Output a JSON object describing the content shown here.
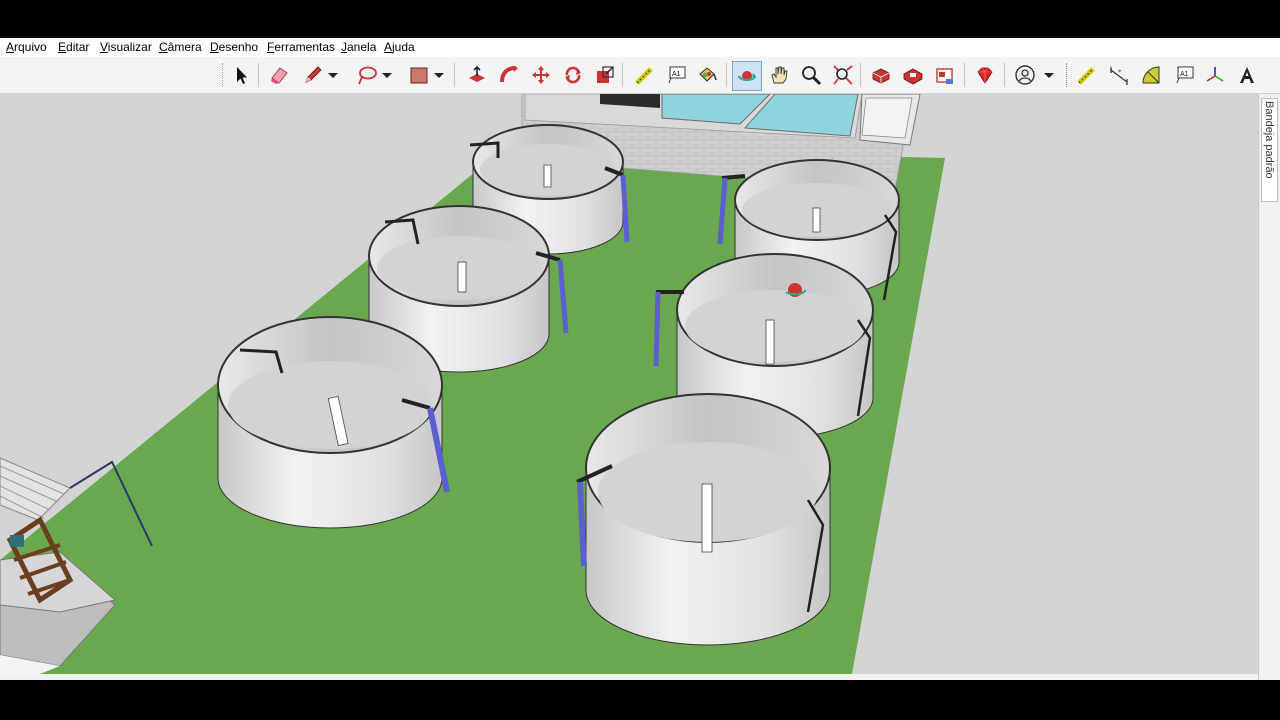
{
  "menu": {
    "items": [
      "Arquivo",
      "Editar",
      "Visualizar",
      "Câmera",
      "Desenho",
      "Ferramentas",
      "Janela",
      "Ajuda"
    ]
  },
  "toolbar": {
    "tools": [
      "select-icon",
      "eraser-icon",
      "pencil-icon",
      "lasso-icon",
      "rectangle-icon",
      "push-pull-icon",
      "follow-me-icon",
      "move-icon",
      "rotate-icon",
      "scale-icon",
      "tape-measure-icon",
      "text-icon",
      "paint-bucket-icon",
      "orbit-icon",
      "pan-icon",
      "zoom-icon",
      "zoom-extents-icon",
      "warehouse-icon",
      "extension-warehouse-icon",
      "extension-manager-icon",
      "ruby-icon",
      "account-icon",
      "tape-measure-2-icon",
      "dimension-icon",
      "protractor-icon",
      "text-2-icon",
      "axes-icon",
      "3d-text-icon"
    ],
    "active_tool": "orbit-icon"
  },
  "tray": {
    "tab_label": "Bandeja padrão"
  },
  "colors": {
    "ground": "#6aa84f",
    "sky": "#d4d4d4",
    "tank": "#e6e6e6",
    "pipe_blue": "#5b5fd0",
    "wall": "#c9c9c9",
    "water": "#8fd3dd"
  }
}
